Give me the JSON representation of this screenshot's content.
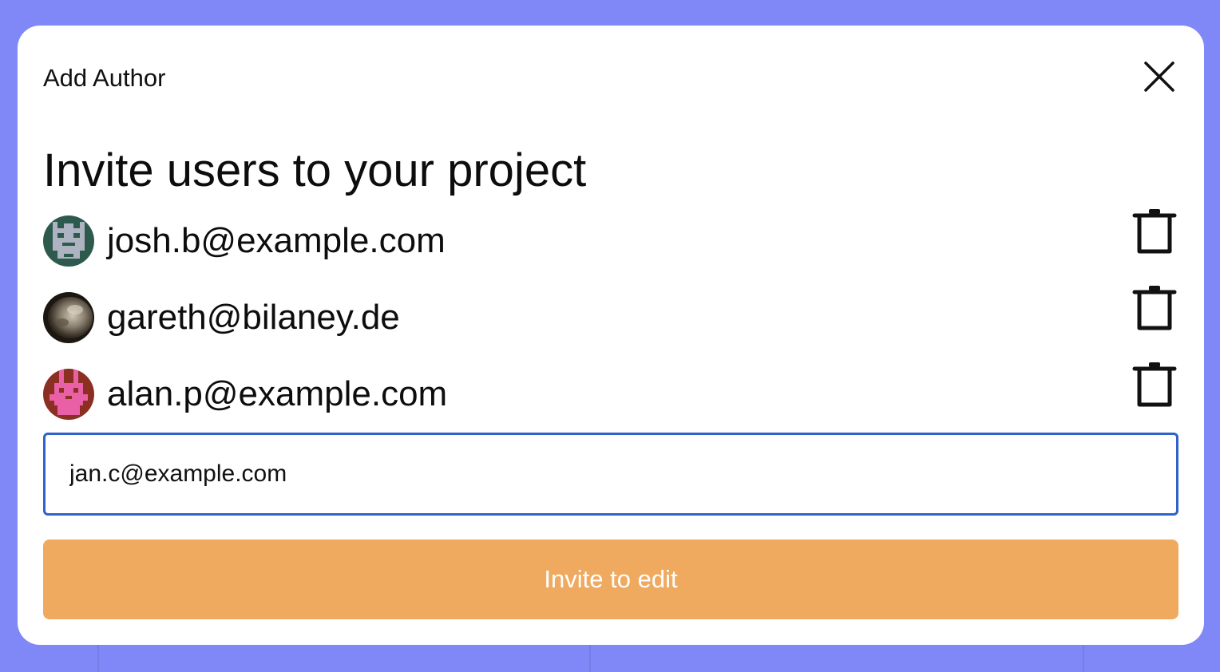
{
  "modal": {
    "title": "Add Author",
    "close_icon": "close-icon",
    "heading": "Invite users to your project"
  },
  "users": [
    {
      "email": "josh.b@example.com",
      "avatar": "pixel-robot-gray",
      "delete_icon": "trash-icon"
    },
    {
      "email": "gareth@bilaney.de",
      "avatar": "photo",
      "delete_icon": "trash-icon"
    },
    {
      "email": "alan.p@example.com",
      "avatar": "pixel-bunny-pink",
      "delete_icon": "trash-icon"
    }
  ],
  "input": {
    "value": "jan.c@example.com"
  },
  "invite_button": {
    "label": "Invite to edit"
  },
  "colors": {
    "backdrop": "#8088f7",
    "input_border": "#2f63c6",
    "invite_button": "#f0aa5f",
    "avatar1_bg": "#2e5a4e",
    "avatar3_bg": "#8a2f22",
    "avatar3_fg": "#e960a6"
  }
}
